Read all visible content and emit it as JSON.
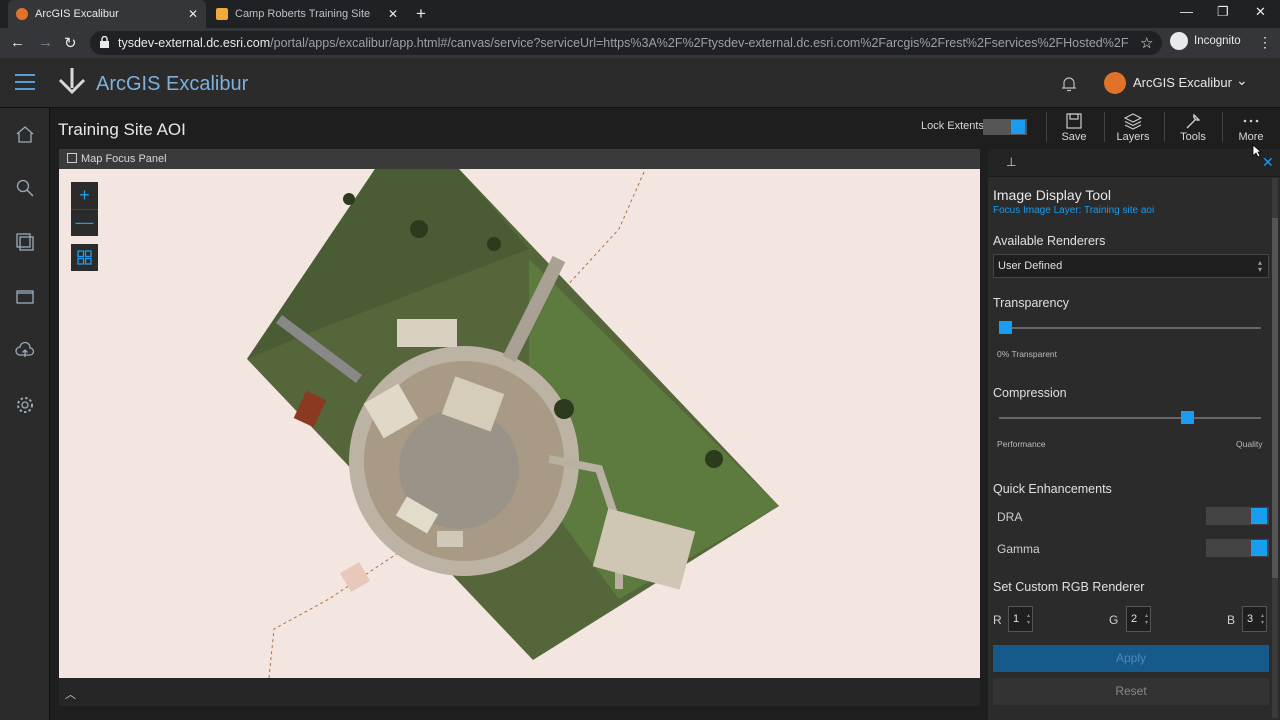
{
  "browser": {
    "tabs": [
      {
        "title": "ArcGIS Excalibur",
        "active": true
      },
      {
        "title": "Camp Roberts Training Site",
        "active": false
      }
    ],
    "url_host": "tysdev-external.dc.esri.com",
    "url_rest": "/portal/apps/excalibur/app.html#/canvas/service?serviceUrl=https%3A%2F%2Ftysdev-external.dc.esri.com%2Farcgis%2Frest%2Fservices%2FHosted%2Ftraining_site_aoi...",
    "incognito_label": "Incognito"
  },
  "app": {
    "name": "ArcGIS Excalibur",
    "account_name": "ArcGIS Excalibur",
    "accent": "#1a9cf0"
  },
  "page": {
    "title": "Training Site AOI",
    "lock_extents_label": "Lock Extents",
    "lock_extents_on": true,
    "toolbar": {
      "save": "Save",
      "layers": "Layers",
      "tools": "Tools",
      "more": "More"
    }
  },
  "map_panel": {
    "title": "Map Focus Panel",
    "zoom_in": "+",
    "zoom_out": "—"
  },
  "tool_panel": {
    "title": "Image Display Tool",
    "subtitle": "Focus Image Layer: Training site aoi",
    "renderers_label": "Available Renderers",
    "renderer_value": "User Defined",
    "transparency_label": "Transparency",
    "transparency_value": 0,
    "transparency_text": "0% Transparent",
    "compression_label": "Compression",
    "compression_value": 0.73,
    "compression_min": "Performance",
    "compression_max": "Quality",
    "quick_label": "Quick Enhancements",
    "dra_label": "DRA",
    "dra_on": true,
    "gamma_label": "Gamma",
    "gamma_on": true,
    "rgb_label": "Set Custom RGB Renderer",
    "r_label": "R",
    "r_value": "1",
    "g_label": "G",
    "g_value": "2",
    "b_label": "B",
    "b_value": "3",
    "apply_label": "Apply",
    "reset_label": "Reset"
  }
}
